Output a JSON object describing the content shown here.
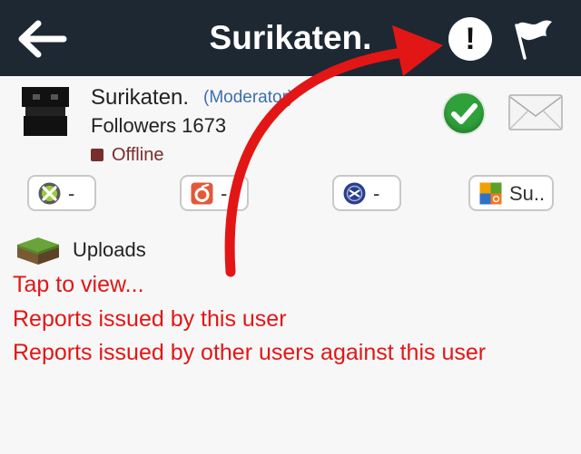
{
  "header": {
    "title": "Surikaten."
  },
  "profile": {
    "username": "Surikaten.",
    "role": "(Moderator)",
    "followers_label": "Followers",
    "followers_count": "1673",
    "status": "Offline"
  },
  "gamer_tags": [
    {
      "platform": "xbox-icon",
      "value": "-"
    },
    {
      "platform": "origin-icon",
      "value": "-"
    },
    {
      "platform": "playstation-network-icon",
      "value": "-"
    },
    {
      "platform": "game-center-icon",
      "value": "Su.."
    }
  ],
  "uploads": {
    "label": "Uploads"
  },
  "annotation": {
    "lines": [
      "Tap to view...",
      "Reports issued by this user",
      "Reports issued by other users against this user"
    ]
  },
  "colors": {
    "navbar": "#1e2833",
    "annotation": "#e31616",
    "status_offline": "#7a2d2d",
    "role_link": "#3b6fb0"
  }
}
